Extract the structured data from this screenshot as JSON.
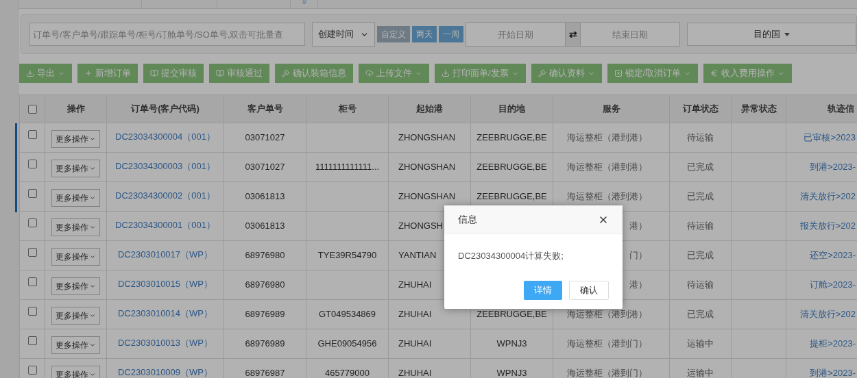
{
  "filters": {
    "search": {
      "placeholder": "订单号/客户单号/跟踪单号/柜号/订舱单号/SO单号,双击可批量查"
    },
    "time_select": {
      "value": "创建时间"
    },
    "quick_ranges": [
      {
        "label": "自定义",
        "selected": true
      },
      {
        "label": "两天",
        "selected": false
      },
      {
        "label": "一周",
        "selected": false
      }
    ],
    "start_date": {
      "placeholder": "开始日期"
    },
    "swap": "⇄",
    "end_date": {
      "placeholder": "结束日期"
    },
    "country": {
      "placeholder": "目的国"
    }
  },
  "toolbar": [
    {
      "label": "导出",
      "kind": "download",
      "dropdown": true
    },
    {
      "label": "新增订单",
      "kind": "plus",
      "dropdown": false
    },
    {
      "label": "提交审核",
      "kind": "book",
      "dropdown": false
    },
    {
      "label": "审核通过",
      "kind": "book",
      "dropdown": false
    },
    {
      "label": "确认装箱信息",
      "kind": "gavel",
      "dropdown": false
    },
    {
      "label": "上传文件",
      "kind": "upload",
      "dropdown": true
    },
    {
      "label": "打印面单/发票",
      "kind": "download",
      "dropdown": true
    },
    {
      "label": "确认资料",
      "kind": "gavel",
      "dropdown": true
    },
    {
      "label": "锁定/取消订单",
      "kind": "checkbox",
      "dropdown": true
    },
    {
      "label": "收入费用操作",
      "kind": "euro",
      "dropdown": true
    }
  ],
  "table": {
    "select_all_checked": false,
    "columns": [
      "操作",
      "订单号(客户代码)",
      "客户单号",
      "柜号",
      "起始港",
      "目的地",
      "服务",
      "订单状态",
      "异常状态",
      "轨迹信"
    ],
    "rows": [
      {
        "checked": false,
        "action": "更多操作",
        "order": "DC23034300004（001）",
        "customer_no": "03071027",
        "container": "",
        "origin": "ZHONGSHAN",
        "destination": "ZEEBRUGGE,BE",
        "service": "海运整柜（港到港）",
        "status": "待运输",
        "track": "已审核>2023"
      },
      {
        "checked": false,
        "action": "更多操作",
        "order": "DC23034300003（001）",
        "customer_no": "03071027",
        "container": "1111111111111...",
        "origin": "ZHONGSHAN",
        "destination": "ZEEBRUGGE,BE",
        "service": "海运整柜（港到港）",
        "status": "已完成",
        "track": "到港>2023-"
      },
      {
        "checked": false,
        "action": "更多操作",
        "order": "DC23034300002（001）",
        "customer_no": "03061813",
        "container": "",
        "origin": "ZHONGSHAN",
        "destination": "ZEEBRUGGE,BE",
        "service": "海运整柜（港到港）",
        "status": "已完成",
        "track": "清关放行>202"
      },
      {
        "checked": false,
        "action": "更多操作",
        "order": "DC23034300001（001）",
        "customer_no": "03061813",
        "container": "",
        "origin": "ZHONGSH",
        "destination": "",
        "service": "港）",
        "status": "待运输",
        "track": "报关放行>202"
      },
      {
        "checked": false,
        "action": "更多操作",
        "order": "DC2303010017（WP）",
        "customer_no": "68976980",
        "container": "TYE39R54790",
        "origin": "YANTIAN",
        "destination": "",
        "service": "门）",
        "status": "已完成",
        "track": "还空>2023-"
      },
      {
        "checked": false,
        "action": "更多操作",
        "order": "DC2303010015（WP）",
        "customer_no": "68976980",
        "container": "",
        "origin": "ZHUHAI",
        "destination": "",
        "service": "港）",
        "status": "待运输",
        "track": "订舱>2023-"
      },
      {
        "checked": false,
        "action": "更多操作",
        "order": "DC2303010014（WP）",
        "customer_no": "68976989",
        "container": "GT049534869",
        "origin": "ZHUHAI",
        "destination": "ZEEBRUGGE,BE",
        "service": "海运整柜（港到港）",
        "status": "已完成",
        "track": "清关放行>202"
      },
      {
        "checked": false,
        "action": "更多操作",
        "order": "DC2303010013（WP）",
        "customer_no": "68976989",
        "container": "GHE09054956",
        "origin": "ZHUHAI",
        "destination": "WPNJ3",
        "service": "海运整柜（港到门）",
        "status": "运输中",
        "track": "提柜>2023-"
      },
      {
        "checked": false,
        "action": "更多操作",
        "order": "DC2303010009（WP）",
        "customer_no": "68976987",
        "container": "465779000",
        "origin": "ZHUHAI",
        "destination": "WPNJ3",
        "service": "海运整柜（港到门）",
        "status": "运输中",
        "track": "到港>2023-"
      }
    ]
  },
  "dialog": {
    "title": "信息",
    "message": "DC23034300004计算失败;",
    "buttons": [
      {
        "label": "详情",
        "kind": "primary"
      },
      {
        "label": "确认",
        "kind": "default"
      }
    ]
  }
}
